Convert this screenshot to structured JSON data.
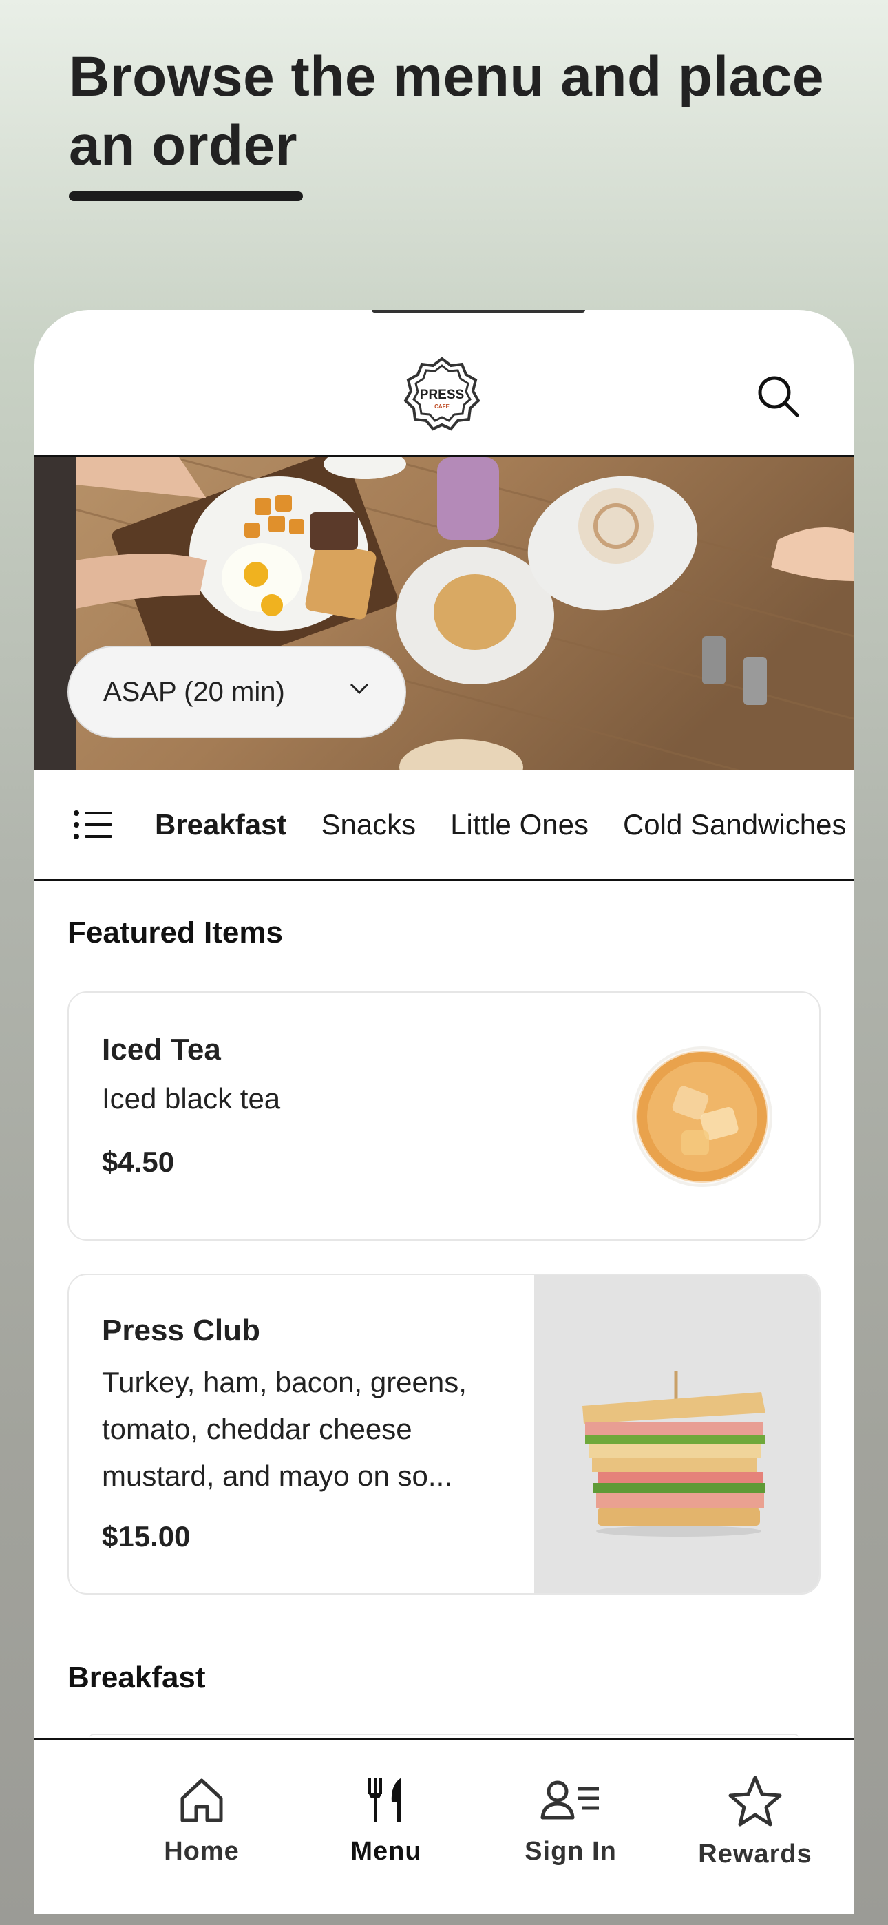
{
  "hero": {
    "title": "Browse the menu and place an order"
  },
  "header": {
    "logo_text": "PRESS",
    "logo_subtext": "CAFE",
    "search_icon": "search-icon"
  },
  "order_time": {
    "selected": "ASAP (20 min)"
  },
  "categories": {
    "items": [
      "Breakfast",
      "Snacks",
      "Little Ones",
      "Cold Sandwiches"
    ],
    "active": "Breakfast"
  },
  "featured": {
    "title": "Featured Items",
    "items": [
      {
        "name": "Iced Tea",
        "description": "Iced black tea",
        "price": "$4.50"
      },
      {
        "name": "Press Club",
        "description": "Turkey, ham, bacon, greens, tomato, cheddar cheese mustard, and mayo on so...",
        "price": "$15.00"
      }
    ]
  },
  "breakfast": {
    "title": "Breakfast"
  },
  "nav": {
    "items": [
      {
        "label": "Home",
        "icon": "home-icon"
      },
      {
        "label": "Menu",
        "icon": "fork-knife-icon"
      },
      {
        "label": "Sign In",
        "icon": "person-list-icon"
      },
      {
        "label": "Rewards",
        "icon": "star-icon"
      }
    ],
    "active": "Menu"
  }
}
